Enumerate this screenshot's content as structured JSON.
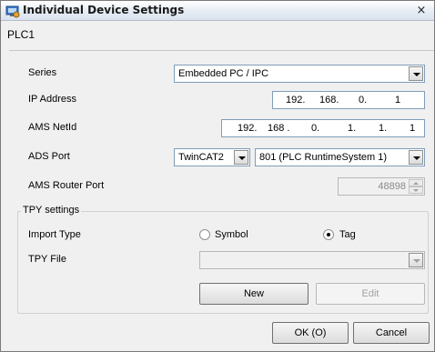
{
  "window": {
    "title": "Individual Device Settings",
    "close_glyph": "×"
  },
  "device_name": "PLC1",
  "fields": {
    "series": {
      "label": "Series",
      "value": "Embedded PC / IPC"
    },
    "ip_address": {
      "label": "IP Address",
      "octets": [
        "192.",
        "168.",
        "0.",
        "1"
      ]
    },
    "ams_netid": {
      "label": "AMS NetId",
      "parts": [
        "192.",
        "168 .",
        "0.",
        "1.",
        "1.",
        "1"
      ]
    },
    "ads_port": {
      "label": "ADS Port",
      "type_value": "TwinCAT2",
      "port_value": "801 (PLC RuntimeSystem 1)"
    },
    "ams_router_port": {
      "label": "AMS Router Port",
      "value": "48898"
    }
  },
  "tpy_settings": {
    "title": "TPY settings",
    "import_type": {
      "label": "Import Type",
      "options": [
        "Symbol",
        "Tag"
      ],
      "selected": "Tag"
    },
    "tpy_file": {
      "label": "TPY File",
      "value": ""
    },
    "new_label": "New",
    "edit_label": "Edit"
  },
  "footer": {
    "ok_label": "OK (O)",
    "cancel_label": "Cancel"
  },
  "icons": {
    "title": "settings-app-icon",
    "close": "close-icon"
  }
}
